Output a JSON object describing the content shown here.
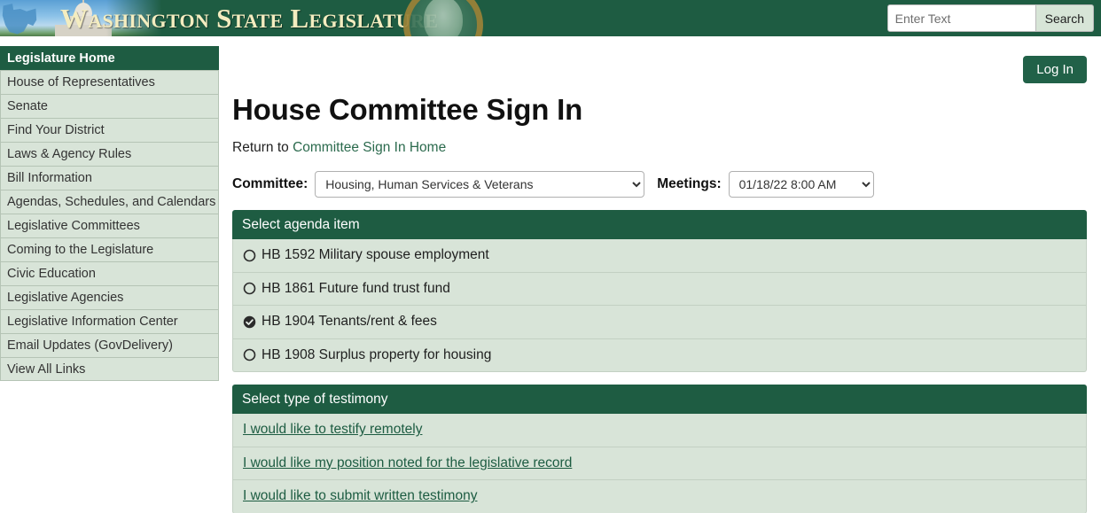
{
  "header": {
    "site_title": "Washington State Legislature",
    "logo_icon": "washington-capitol-image",
    "seal_icon": "washington-state-seal",
    "search": {
      "placeholder": "Enter Text",
      "value": "",
      "button_label": "Search"
    },
    "colors": {
      "brand_green": "#1e5c42",
      "panel_green": "#d8e4d8",
      "title_gold": "#f4edc0"
    }
  },
  "sidebar": {
    "items": [
      {
        "label": "Legislature Home",
        "active": true
      },
      {
        "label": "House of Representatives",
        "active": false
      },
      {
        "label": "Senate",
        "active": false
      },
      {
        "label": "Find Your District",
        "active": false
      },
      {
        "label": "Laws & Agency Rules",
        "active": false
      },
      {
        "label": "Bill Information",
        "active": false
      },
      {
        "label": "Agendas, Schedules, and Calendars",
        "active": false
      },
      {
        "label": "Legislative Committees",
        "active": false
      },
      {
        "label": "Coming to the Legislature",
        "active": false
      },
      {
        "label": "Civic Education",
        "active": false
      },
      {
        "label": "Legislative Agencies",
        "active": false
      },
      {
        "label": "Legislative Information Center",
        "active": false
      },
      {
        "label": "Email Updates (GovDelivery)",
        "active": false
      },
      {
        "label": "View All Links",
        "active": false
      }
    ]
  },
  "main": {
    "login_label": "Log In",
    "page_title": "House Committee Sign In",
    "return_prefix": "Return to ",
    "return_link": "Committee Sign In Home",
    "committee_label": "Committee:",
    "committee_value": "Housing, Human Services & Veterans",
    "meetings_label": "Meetings:",
    "meetings_value": "01/18/22 8:00 AM",
    "agenda_panel": {
      "title": "Select agenda item",
      "items": [
        {
          "label": "HB 1592 Military spouse employment",
          "selected": false
        },
        {
          "label": "HB 1861 Future fund trust fund",
          "selected": false
        },
        {
          "label": "HB 1904 Tenants/rent & fees",
          "selected": true
        },
        {
          "label": "HB 1908 Surplus property for housing",
          "selected": false
        }
      ]
    },
    "testimony_panel": {
      "title": "Select type of testimony",
      "items": [
        {
          "label": "I would like to testify remotely"
        },
        {
          "label": "I would like my position noted for the legislative record"
        },
        {
          "label": "I would like to submit written testimony"
        }
      ]
    }
  }
}
